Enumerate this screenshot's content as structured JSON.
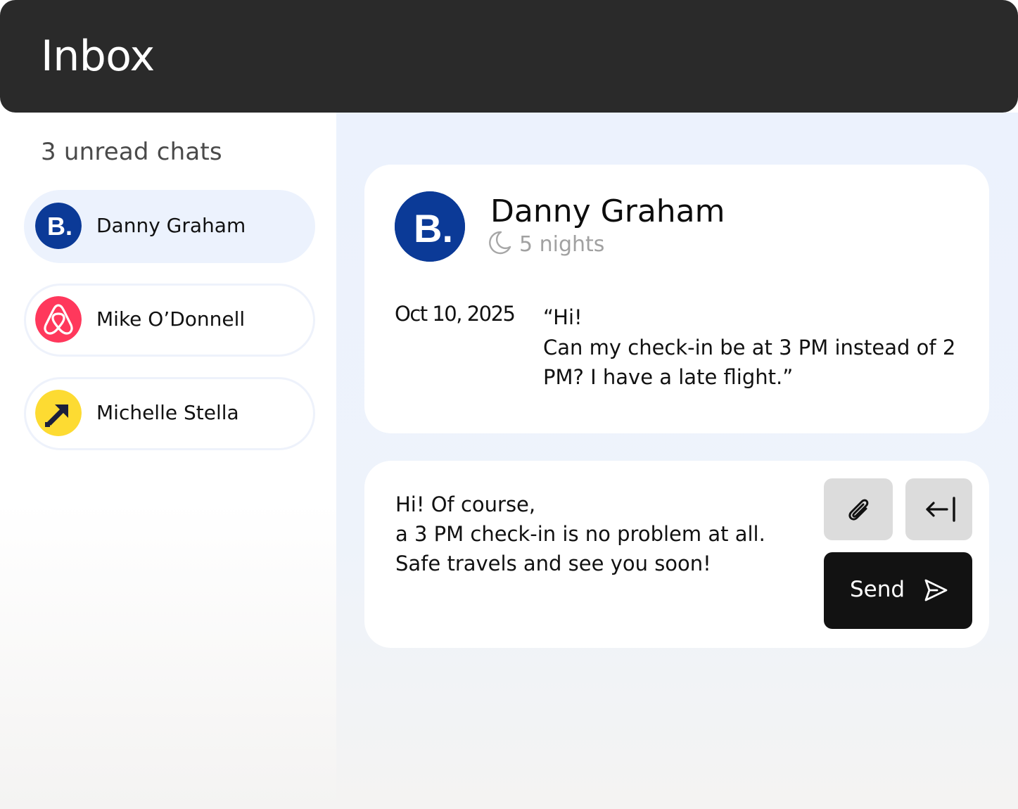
{
  "header": {
    "title": "Inbox"
  },
  "sidebar": {
    "unread_label": "3 unread chats",
    "chats": [
      {
        "name": "Danny Graham",
        "source_icon": "booking-logo-icon",
        "logo_text": "B.",
        "active": true,
        "color": "#0b3a97"
      },
      {
        "name": "Mike O’Donnell",
        "source_icon": "airbnb-logo-icon",
        "active": false,
        "color": "#ff385c"
      },
      {
        "name": "Michelle Stella",
        "source_icon": "expedia-logo-icon",
        "active": false,
        "color": "#fddb32"
      }
    ]
  },
  "conversation": {
    "guest": {
      "name": "Danny Graham",
      "logo_text": "B.",
      "stay_icon": "moon-icon",
      "stay": "5 nights"
    },
    "message": {
      "date": "Oct 10, 2025",
      "lines": [
        "“Hi!",
        "Can my check-in be at 3 PM instead of 2",
        "PM? I have a late flight.”"
      ]
    }
  },
  "reply": {
    "lines": [
      "Hi! Of course,",
      "a 3 PM check-in is no problem at all.",
      "Safe travels and see you soon!"
    ],
    "attach_icon": "paperclip-icon",
    "back_icon": "arrow-left-to-line-icon",
    "send_label": "Send",
    "send_icon": "send-icon"
  },
  "colors": {
    "header_bg": "#2a2a2a",
    "active_chat_bg": "#ecf2fd",
    "booking_blue": "#0b3a97",
    "airbnb_red": "#ff385c",
    "expedia_yellow": "#fddb32",
    "send_bg": "#121212",
    "icon_button_bg": "#dcdcdc"
  }
}
